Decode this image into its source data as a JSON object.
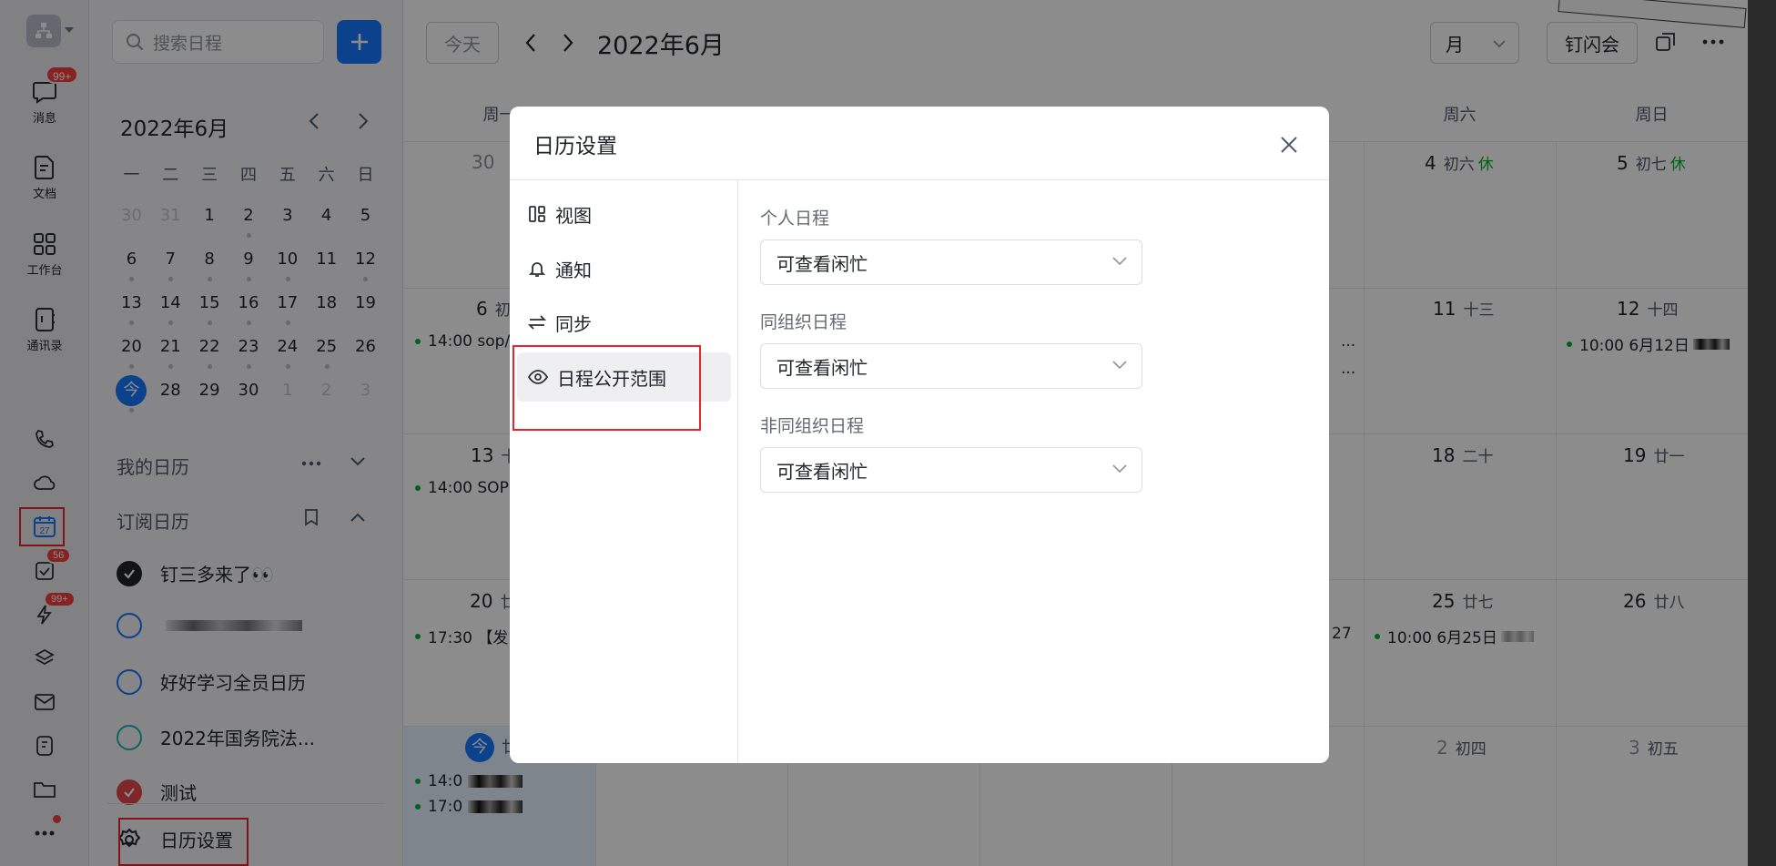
{
  "rail": {
    "items": [
      {
        "name": "messages",
        "label": "消息",
        "badge": "99+"
      },
      {
        "name": "docs",
        "label": "文档"
      },
      {
        "name": "workbench",
        "label": "工作台"
      },
      {
        "name": "contacts",
        "label": "通讯录"
      }
    ],
    "badge_todo": "56",
    "badge_ding": "99+",
    "calendar_day": "27"
  },
  "sidebar": {
    "search_placeholder": "搜索日程",
    "mini_title": "2022年6月",
    "weekdays": [
      "一",
      "二",
      "三",
      "四",
      "五",
      "六",
      "日"
    ],
    "today_label": "今",
    "weeks": [
      [
        "30",
        "31",
        "1",
        "2",
        "3",
        "4",
        "5"
      ],
      [
        "6",
        "7",
        "8",
        "9",
        "10",
        "11",
        "12"
      ],
      [
        "13",
        "14",
        "15",
        "16",
        "17",
        "18",
        "19"
      ],
      [
        "20",
        "21",
        "22",
        "23",
        "24",
        "25",
        "26"
      ],
      [
        "今",
        "28",
        "29",
        "30",
        "1",
        "2",
        "3"
      ]
    ],
    "my_calendars": "我的日历",
    "subscribed": "订阅日历",
    "calendars": [
      {
        "name": "钉三多来了👀"
      },
      {
        "name": ""
      },
      {
        "name": "好好学习全员日历"
      },
      {
        "name": "2022年国务院法..."
      },
      {
        "name": "测试"
      }
    ],
    "settings_label": "日历设置"
  },
  "main": {
    "today_button": "今天",
    "month_title": "2022年6月",
    "view": "月",
    "meeting_button": "钉闪会",
    "weekdays": [
      "周一",
      "周二",
      "周三",
      "周四",
      "周五",
      "周六",
      "周日"
    ],
    "days": [
      {
        "num": "30",
        "lunar": "",
        "dim": true
      },
      {
        "num": "4",
        "lunar": "初六",
        "rest": "休"
      },
      {
        "num": "5",
        "lunar": "初七",
        "rest": "休"
      },
      {
        "num": "6",
        "lunar": "初"
      },
      {
        "num": "11",
        "lunar": "十三"
      },
      {
        "num": "12",
        "lunar": "十四"
      },
      {
        "num": "13",
        "lunar": "十"
      },
      {
        "num": "18",
        "lunar": "二十"
      },
      {
        "num": "19",
        "lunar": "廿一"
      },
      {
        "num": "20",
        "lunar": "廿"
      },
      {
        "num": "25",
        "lunar": "廿七"
      },
      {
        "num": "26",
        "lunar": "廿八"
      },
      {
        "num": "今",
        "lunar": "廿"
      },
      {
        "num": "2",
        "lunar": "初四"
      },
      {
        "num": "3",
        "lunar": "初五"
      }
    ],
    "events": [
      {
        "text": "14:00 sop/"
      },
      {
        "text": "10:00 6月12日"
      },
      {
        "text": "14:00 SOP"
      },
      {
        "text": "17:30 【发"
      },
      {
        "text": "10:00 6月25日"
      },
      {
        "text": "14:0"
      },
      {
        "text": "17:0"
      },
      {
        "text": "..."
      },
      {
        "text": "..."
      },
      {
        "text": "27"
      }
    ]
  },
  "modal": {
    "title": "日历设置",
    "nav": [
      {
        "label": "视图"
      },
      {
        "label": "通知"
      },
      {
        "label": "同步"
      },
      {
        "label": "日程公开范围"
      }
    ],
    "fields": [
      {
        "label": "个人日程",
        "value": "可查看闲忙"
      },
      {
        "label": "同组织日程",
        "value": "可查看闲忙"
      },
      {
        "label": "非同组织日程",
        "value": "可查看闲忙"
      }
    ]
  },
  "colors": {
    "accent": "#1677ff",
    "badge": "#f53f3f",
    "highlight": "#e8252c",
    "event_dot": "#00b42a"
  }
}
